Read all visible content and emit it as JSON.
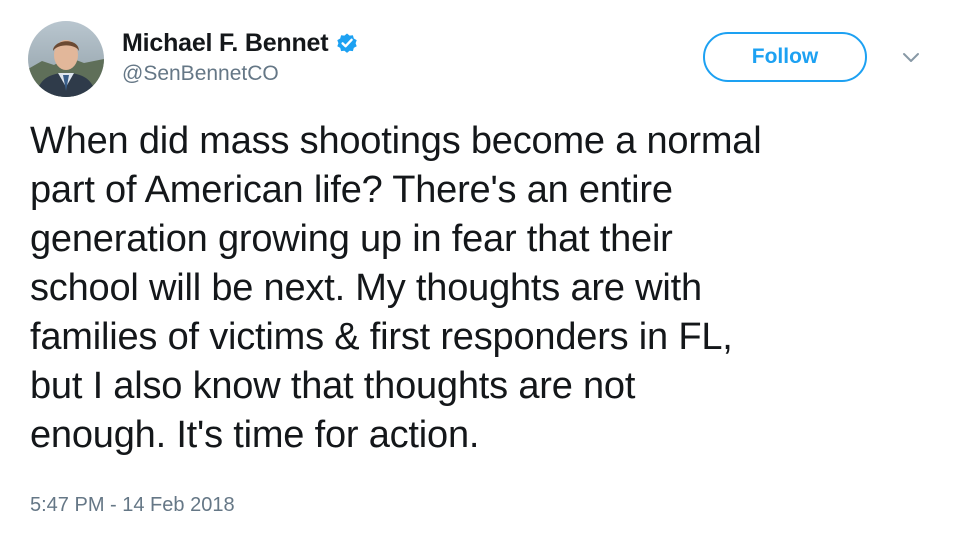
{
  "tweet": {
    "display_name": "Michael F. Bennet",
    "handle": "@SenBennetCO",
    "follow_label": "Follow",
    "text": "When did mass shootings become a normal\npart of American life? There's an entire\ngeneration growing up in fear that their\nschool will be next.  My thoughts are with\nfamilies of victims & first responders in FL,\nbut I also know that thoughts are not\nenough. It's time for action.",
    "timestamp": "5:47 PM - 14 Feb 2018"
  },
  "icons": {
    "verified": "verified-badge-icon",
    "menu": "chevron-down-icon",
    "avatar": "profile-photo"
  },
  "colors": {
    "accent": "#1da1f2",
    "text": "#14171a",
    "secondary": "#657786"
  }
}
